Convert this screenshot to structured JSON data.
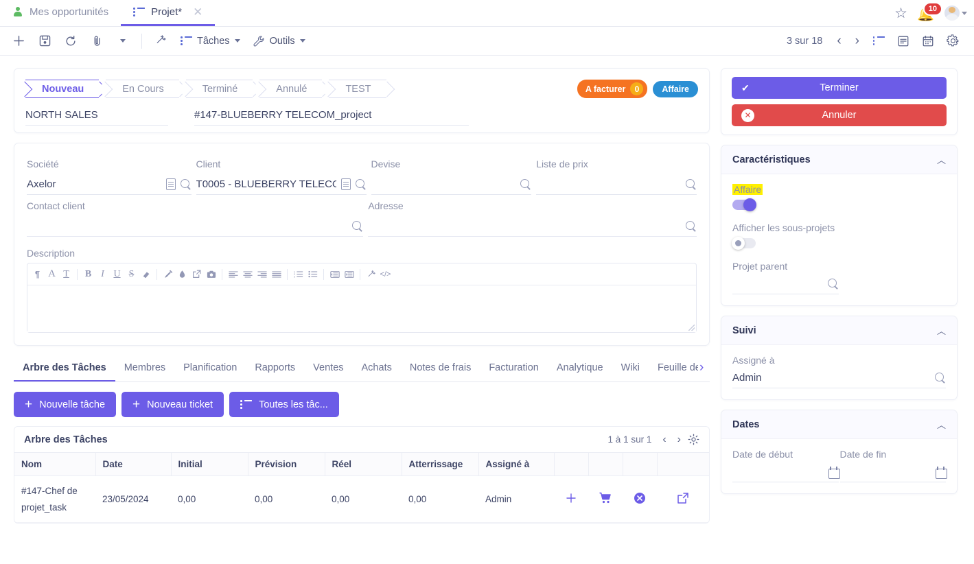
{
  "window": {
    "tabs": [
      {
        "label": "Mes opportunités",
        "icon": "person-icon",
        "active": false,
        "closable": false
      },
      {
        "label": "Projet*",
        "icon": "list-menu-icon",
        "active": true,
        "closable": true
      }
    ],
    "notifications_count": "10"
  },
  "toolbar": {
    "new_label": "+",
    "tasks_label": "Tâches",
    "tools_label": "Outils",
    "pager_text": "3 sur 18"
  },
  "status": {
    "steps": [
      {
        "label": "Nouveau",
        "active": true
      },
      {
        "label": "En Cours",
        "active": false
      },
      {
        "label": "Terminé",
        "active": false
      },
      {
        "label": "Annulé",
        "active": false
      },
      {
        "label": "TEST",
        "active": false
      }
    ],
    "badge_invoice_label": "A facturer",
    "badge_invoice_count": "0",
    "badge_business": "Affaire",
    "badge_invoice_color": "#f57322",
    "badge_business_color": "#2a8fd4",
    "field_team": "NORTH SALES",
    "field_project_code": "#147-BLUEBERRY TELECOM_project"
  },
  "form": {
    "societe": {
      "label": "Société",
      "value": "Axelor"
    },
    "client": {
      "label": "Client",
      "value": "T0005 - BLUEBERRY TELECO"
    },
    "devise": {
      "label": "Devise",
      "value": ""
    },
    "liste_de_prix": {
      "label": "Liste de prix",
      "value": ""
    },
    "contact_client": {
      "label": "Contact client",
      "value": ""
    },
    "adresse": {
      "label": "Adresse",
      "value": ""
    },
    "description": {
      "label": "Description",
      "value": ""
    }
  },
  "editor_toolbar": [
    {
      "name": "paragraph-icon",
      "glyph": "¶"
    },
    {
      "name": "font-family-icon",
      "glyph": "A"
    },
    {
      "name": "font-size-icon",
      "glyph": "T"
    },
    {
      "name": "bold-icon",
      "glyph": "B"
    },
    {
      "name": "italic-icon",
      "glyph": "I"
    },
    {
      "name": "underline-icon",
      "glyph": "U"
    },
    {
      "name": "strikethrough-icon",
      "glyph": "S"
    },
    {
      "name": "clear-format-icon",
      "glyph": "◢"
    },
    {
      "name": "text-color-icon",
      "glyph": "brush"
    },
    {
      "name": "highlight-color-icon",
      "glyph": "drop"
    },
    {
      "name": "insert-link-icon",
      "glyph": "link"
    },
    {
      "name": "insert-image-icon",
      "glyph": "camera"
    },
    {
      "name": "align-left-icon",
      "glyph": "lines"
    },
    {
      "name": "align-center-icon",
      "glyph": "lines"
    },
    {
      "name": "align-right-icon",
      "glyph": "lines"
    },
    {
      "name": "align-justify-icon",
      "glyph": "lines"
    },
    {
      "name": "ordered-list-icon",
      "glyph": "ol"
    },
    {
      "name": "unordered-list-icon",
      "glyph": "ul"
    },
    {
      "name": "indent-decrease-icon",
      "glyph": "outdent"
    },
    {
      "name": "indent-increase-icon",
      "glyph": "indent"
    },
    {
      "name": "magic-format-icon",
      "glyph": "wand"
    },
    {
      "name": "source-code-icon",
      "glyph": "</>"
    }
  ],
  "tabs": {
    "items": [
      {
        "label": "Arbre des Tâches",
        "active": true
      },
      {
        "label": "Membres",
        "active": false
      },
      {
        "label": "Planification",
        "active": false
      },
      {
        "label": "Rapports",
        "active": false
      },
      {
        "label": "Ventes",
        "active": false
      },
      {
        "label": "Achats",
        "active": false
      },
      {
        "label": "Notes de frais",
        "active": false
      },
      {
        "label": "Facturation",
        "active": false
      },
      {
        "label": "Analytique",
        "active": false
      },
      {
        "label": "Wiki",
        "active": false
      },
      {
        "label": "Feuille de",
        "active": false
      }
    ]
  },
  "actions": {
    "new_task": "Nouvelle tâche",
    "new_ticket": "Nouveau ticket",
    "all_tasks": "Toutes les tâc..."
  },
  "grid": {
    "title": "Arbre des Tâches",
    "pagination": "1 à 1 sur 1",
    "columns": [
      "Nom",
      "Date",
      "Initial",
      "Prévision",
      "Réel",
      "Atterrissage",
      "Assigné à",
      "",
      "",
      "",
      ""
    ],
    "rows": [
      {
        "nom": "#147-Chef de projet_task",
        "date": "23/05/2024",
        "initial": "0,00",
        "prevision": "0,00",
        "reel": "0,00",
        "atterrissage": "0,00",
        "assigne_a": "Admin",
        "actions": [
          "add-icon",
          "cart-icon",
          "cancel-circle-icon",
          "open-external-icon"
        ]
      }
    ]
  },
  "sidebar": {
    "primary_action": "Terminer",
    "secondary_action": "Annuler",
    "panels": [
      {
        "title": "Caractéristiques",
        "fields": {
          "affaire_label": "Affaire",
          "affaire_on": true,
          "sous_projets_label": "Afficher les sous-projets",
          "sous_projets_on": false,
          "projet_parent_label": "Projet parent",
          "projet_parent_value": ""
        }
      },
      {
        "title": "Suivi",
        "fields": {
          "assigne_label": "Assigné à",
          "assigne_value": "Admin"
        }
      },
      {
        "title": "Dates",
        "fields": {
          "date_debut_label": "Date de début",
          "date_debut_value": "",
          "date_fin_label": "Date de fin",
          "date_fin_value": ""
        }
      }
    ]
  },
  "colors": {
    "accent": "#6c5ce7",
    "danger": "#e14b4b",
    "highlight": "#fff000",
    "orange": "#f57322",
    "blue": "#2a8fd4"
  }
}
